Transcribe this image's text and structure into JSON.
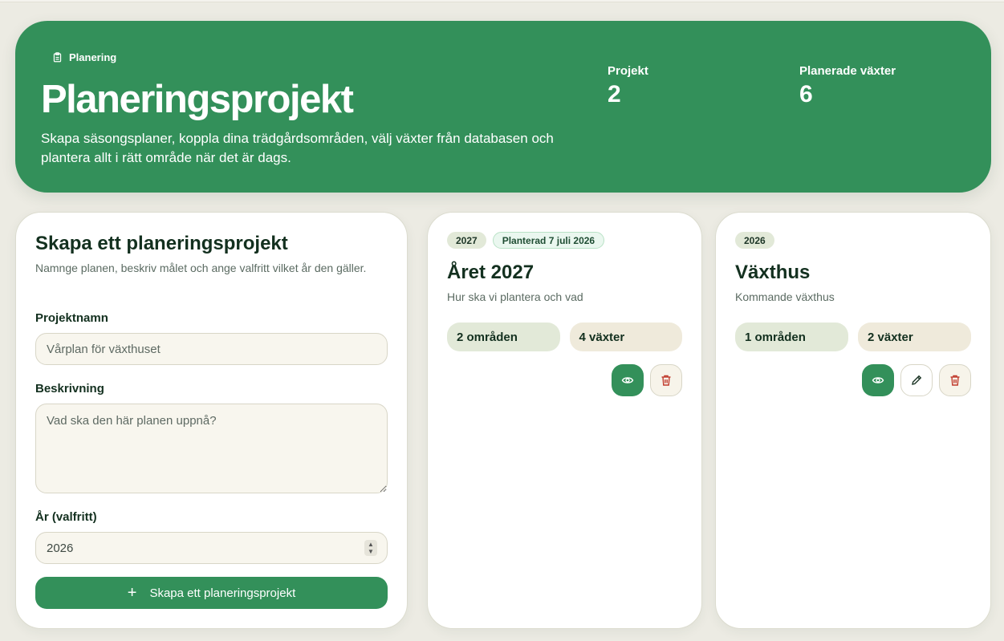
{
  "hero": {
    "badge": "Planering",
    "title": "Planeringsprojekt",
    "description": "Skapa säsongsplaner, koppla dina trädgårdsområden, välj växter från databasen och plantera allt i rätt område när det är dags.",
    "stats": [
      {
        "label": "Projekt",
        "value": "2"
      },
      {
        "label": "Planerade växter",
        "value": "6"
      }
    ]
  },
  "form": {
    "title": "Skapa ett planeringsprojekt",
    "subtitle": "Namnge planen, beskriv målet och ange valfritt vilket år den gäller.",
    "name_label": "Projektnamn",
    "name_placeholder": "Vårplan för växthuset",
    "description_label": "Beskrivning",
    "description_placeholder": "Vad ska den här planen uppnå?",
    "year_label": "År (valfritt)",
    "year_value": "2026",
    "submit_label": "Skapa ett planeringsprojekt"
  },
  "projects": [
    {
      "year": "2027",
      "status": "Planterad 7 juli 2026",
      "title": "Året 2027",
      "description": "Hur ska vi plantera och vad",
      "areas": "2 områden",
      "plants": "4 växter"
    },
    {
      "year": "2026",
      "title": "Växthus",
      "description": "Kommande växthus",
      "areas": "1 områden",
      "plants": "2 växter"
    }
  ],
  "colors": {
    "primary": "#33905a",
    "danger": "#c0392b",
    "background": "#ecebe3"
  }
}
